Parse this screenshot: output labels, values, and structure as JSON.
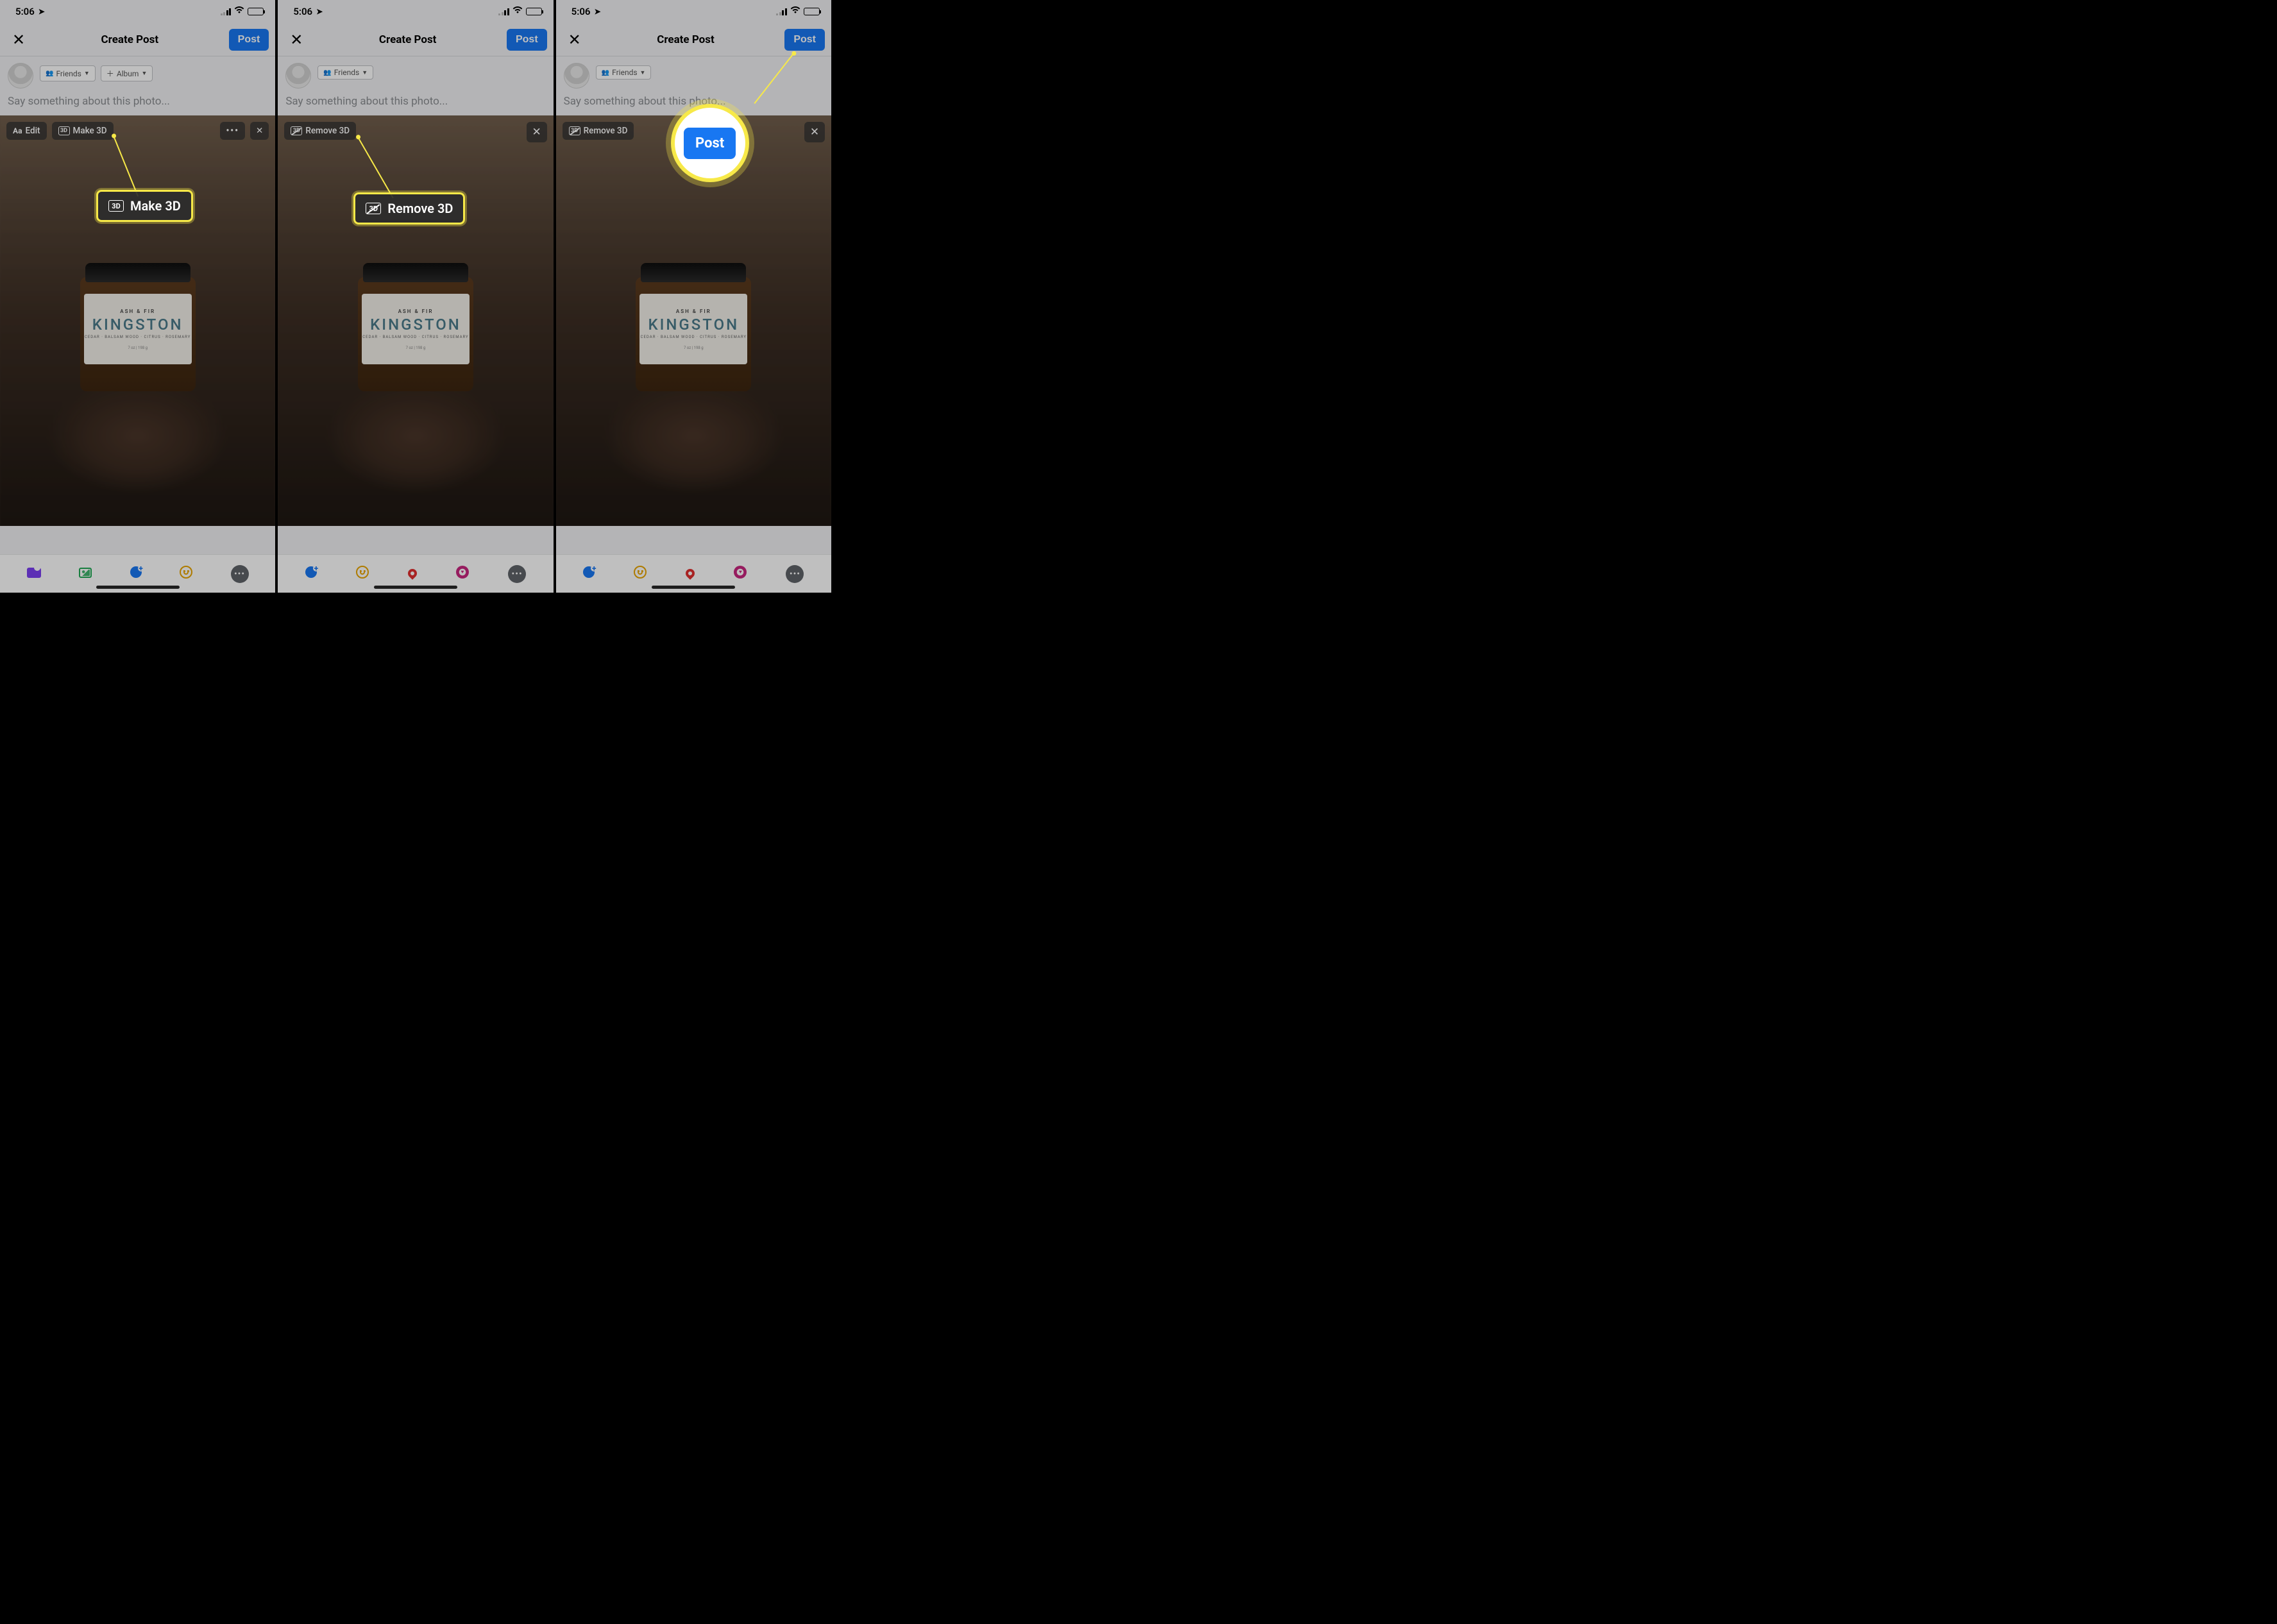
{
  "status": {
    "time": "5:06"
  },
  "header": {
    "title": "Create Post",
    "post_label": "Post"
  },
  "audience": {
    "friends_label": "Friends",
    "album_label": "Album"
  },
  "caption_placeholder": "Say something about this photo...",
  "photo_chips": {
    "edit": "Edit",
    "make3d": "Make 3D",
    "remove3d": "Remove 3D"
  },
  "jar": {
    "brand": "ASH & FIR",
    "name": "KINGSTON",
    "sub": "CEDAR · BALSAM WOOD · CITRUS · ROSEMARY",
    "weight": "7 oz | 198 g"
  },
  "callouts": {
    "make3d": "Make 3D",
    "remove3d": "Remove 3D",
    "post": "Post"
  }
}
